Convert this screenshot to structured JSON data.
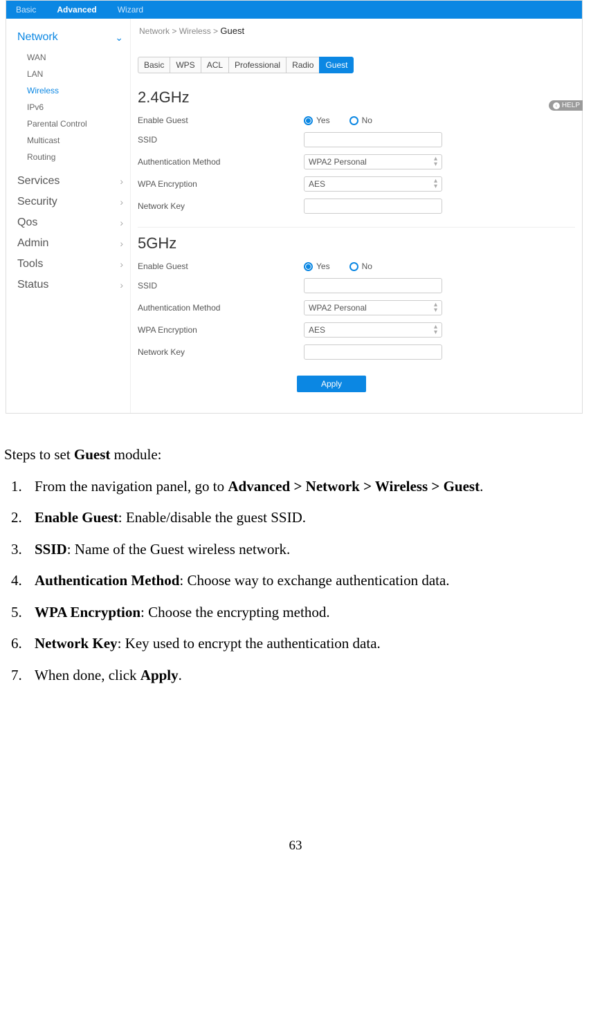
{
  "topnav": {
    "basic": "Basic",
    "advanced": "Advanced",
    "wizard": "Wizard"
  },
  "breadcrumb": {
    "p1": "Network",
    "p2": "Wireless",
    "p3": "Guest"
  },
  "sidebar": {
    "network": "Network",
    "sub": {
      "wan": "WAN",
      "lan": "LAN",
      "wireless": "Wireless",
      "ipv6": "IPv6",
      "parental": "Parental Control",
      "multicast": "Multicast",
      "routing": "Routing"
    },
    "services": "Services",
    "security": "Security",
    "qos": "Qos",
    "admin": "Admin",
    "tools": "Tools",
    "status": "Status"
  },
  "subtabs": {
    "basic": "Basic",
    "wps": "WPS",
    "acl": "ACL",
    "professional": "Professional",
    "radio": "Radio",
    "guest": "Guest"
  },
  "help": "HELP",
  "band24": {
    "title": "2.4GHz",
    "enable": "Enable Guest",
    "yes": "Yes",
    "no": "No",
    "ssid": "SSID",
    "auth": "Authentication Method",
    "auth_val": "WPA2 Personal",
    "enc": "WPA Encryption",
    "enc_val": "AES",
    "key": "Network Key"
  },
  "band5": {
    "title": "5GHz",
    "enable": "Enable Guest",
    "yes": "Yes",
    "no": "No",
    "ssid": "SSID",
    "auth": "Authentication Method",
    "auth_val": "WPA2 Personal",
    "enc": "WPA Encryption",
    "enc_val": "AES",
    "key": "Network Key"
  },
  "apply": "Apply",
  "doc": {
    "heading_pre": "Steps to set ",
    "heading_bold": "Guest",
    "heading_post": " module:",
    "s1_pre": "From the navigation panel, go to ",
    "s1_bold": "Advanced > Network > Wireless > Guest",
    "s1_post": ".",
    "s2_bold": "Enable Guest",
    "s2_post": ": Enable/disable the guest SSID.",
    "s3_bold": "SSID",
    "s3_post": ": Name of the Guest wireless network.",
    "s4_bold": "Authentication Method",
    "s4_post": ": Choose way to exchange authentication data.",
    "s5_bold": "WPA Encryption",
    "s5_post": ": Choose the encrypting method.",
    "s6_bold": "Network Key",
    "s6_post": ": Key used to encrypt the authentication data.",
    "s7_pre": "When done, click ",
    "s7_bold": "Apply",
    "s7_post": "."
  },
  "pagenum": "63"
}
